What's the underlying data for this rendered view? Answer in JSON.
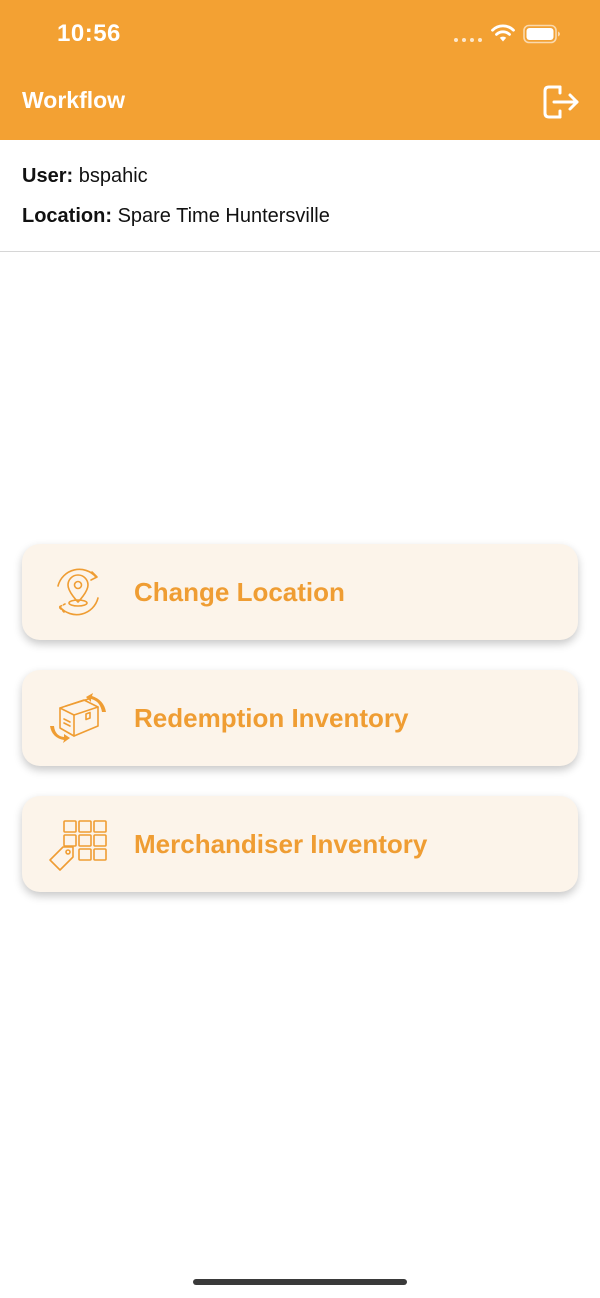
{
  "status_bar": {
    "time": "10:56"
  },
  "nav": {
    "title": "Workflow",
    "logout_icon": "logout-icon"
  },
  "info": {
    "user_label": "User:",
    "user_value": "bspahic",
    "location_label": "Location:",
    "location_value": "Spare Time Huntersville"
  },
  "actions": [
    {
      "label": "Change Location",
      "icon": "location-change-icon"
    },
    {
      "label": "Redemption Inventory",
      "icon": "box-rotate-icon"
    },
    {
      "label": "Merchandiser Inventory",
      "icon": "inventory-grid-tag-icon"
    }
  ],
  "colors": {
    "header": "#f3a133",
    "accent_text": "#ef9d33",
    "card_bg": "#fcf4ea"
  }
}
